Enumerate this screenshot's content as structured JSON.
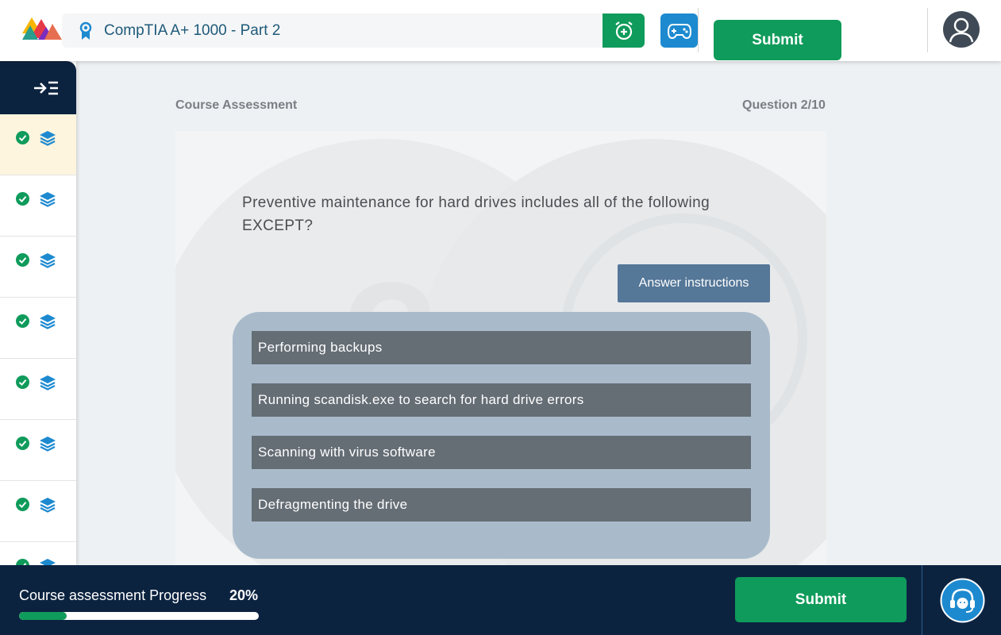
{
  "header": {
    "course_title": "CompTIA A+ 1000 - Part 2",
    "submit_label": "Submit"
  },
  "sidebar": {
    "items": [
      {
        "state": "completed",
        "active": true
      },
      {
        "state": "completed",
        "active": false
      },
      {
        "state": "completed",
        "active": false
      },
      {
        "state": "completed",
        "active": false
      },
      {
        "state": "completed",
        "active": false
      },
      {
        "state": "completed",
        "active": false
      },
      {
        "state": "completed",
        "active": false
      },
      {
        "state": "completed",
        "active": false
      }
    ]
  },
  "main": {
    "section_label": "Course Assessment",
    "question_counter": "Question 2/10",
    "question_text": "Preventive maintenance for hard drives includes all of the following EXCEPT?",
    "instructions_label": "Answer instructions",
    "options": [
      "Performing backups",
      "Running scandisk.exe to search for hard drive errors",
      "Scanning with virus software",
      "Defragmenting the drive"
    ]
  },
  "footer": {
    "progress_label": "Course assessment Progress",
    "progress_percent_text": "20%",
    "progress_fraction": 0.2,
    "submit_label": "Submit"
  },
  "colors": {
    "primary_green": "#0f9b5b",
    "navy": "#0c2340",
    "blue": "#1d8ad0",
    "option_bg": "#656d75",
    "options_panel": "#a9bbcb",
    "instructions_btn": "#557798"
  },
  "icons": {
    "logo": "multicolor-triangle-logo",
    "course_badge": "award-badge-icon",
    "alarm": "alarm-clock-plus-icon",
    "game": "gamepad-icon",
    "avatar": "user-avatar-icon",
    "sidebar_toggle": "arrow-right-list-icon",
    "check": "check-circle-icon",
    "layers": "layers-icon",
    "support": "headset-support-icon"
  }
}
